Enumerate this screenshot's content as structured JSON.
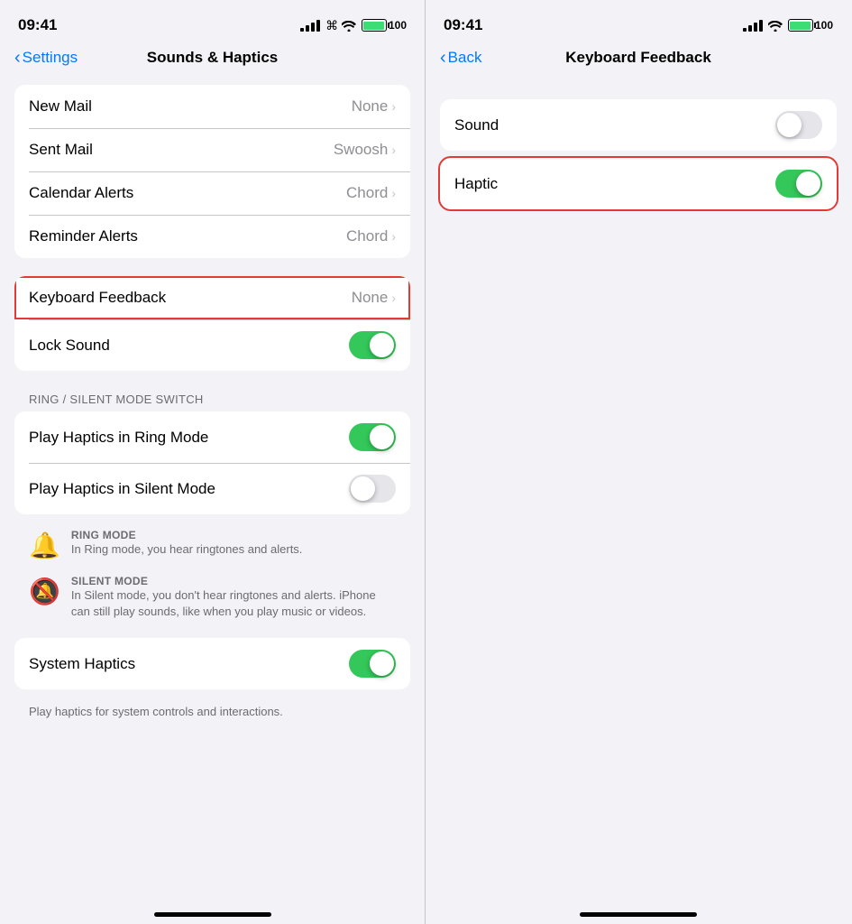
{
  "left": {
    "status": {
      "time": "09:41",
      "battery_label": "100"
    },
    "nav": {
      "back_label": "Settings",
      "title": "Sounds & Haptics"
    },
    "rows": [
      {
        "id": "new-mail",
        "label": "New Mail",
        "value": "None",
        "has_chevron": true,
        "toggle": null,
        "highlighted": false
      },
      {
        "id": "sent-mail",
        "label": "Sent Mail",
        "value": "Swoosh",
        "has_chevron": true,
        "toggle": null,
        "highlighted": false
      },
      {
        "id": "calendar-alerts",
        "label": "Calendar Alerts",
        "value": "Chord",
        "has_chevron": true,
        "toggle": null,
        "highlighted": false
      },
      {
        "id": "reminder-alerts",
        "label": "Reminder Alerts",
        "value": "Chord",
        "has_chevron": true,
        "toggle": null,
        "highlighted": false
      }
    ],
    "keyboard_feedback": {
      "label": "Keyboard Feedback",
      "value": "None",
      "has_chevron": true,
      "highlighted": true
    },
    "lock_sound": {
      "label": "Lock Sound",
      "toggle_on": true
    },
    "section_ring": "Ring / Silent Mode Switch",
    "ring_rows": [
      {
        "id": "play-haptics-ring",
        "label": "Play Haptics in Ring Mode",
        "toggle_on": true
      },
      {
        "id": "play-haptics-silent",
        "label": "Play Haptics in Silent Mode",
        "toggle_on": false
      }
    ],
    "ring_mode": {
      "icon": "🔔",
      "heading": "Ring Mode",
      "desc": "In Ring mode, you hear ringtones and alerts."
    },
    "silent_mode": {
      "icon": "🔕",
      "heading": "Silent Mode",
      "desc": "In Silent mode, you don't hear ringtones and alerts. iPhone can still play sounds, like when you play music or videos."
    },
    "system_haptics": {
      "label": "System Haptics",
      "toggle_on": true
    },
    "system_haptics_desc": "Play haptics for system controls and interactions."
  },
  "right": {
    "status": {
      "time": "09:41",
      "battery_label": "100"
    },
    "nav": {
      "back_label": "Back",
      "title": "Keyboard Feedback"
    },
    "sound_row": {
      "label": "Sound",
      "toggle_on": false
    },
    "haptic_row": {
      "label": "Haptic",
      "toggle_on": true,
      "highlighted": true
    }
  }
}
